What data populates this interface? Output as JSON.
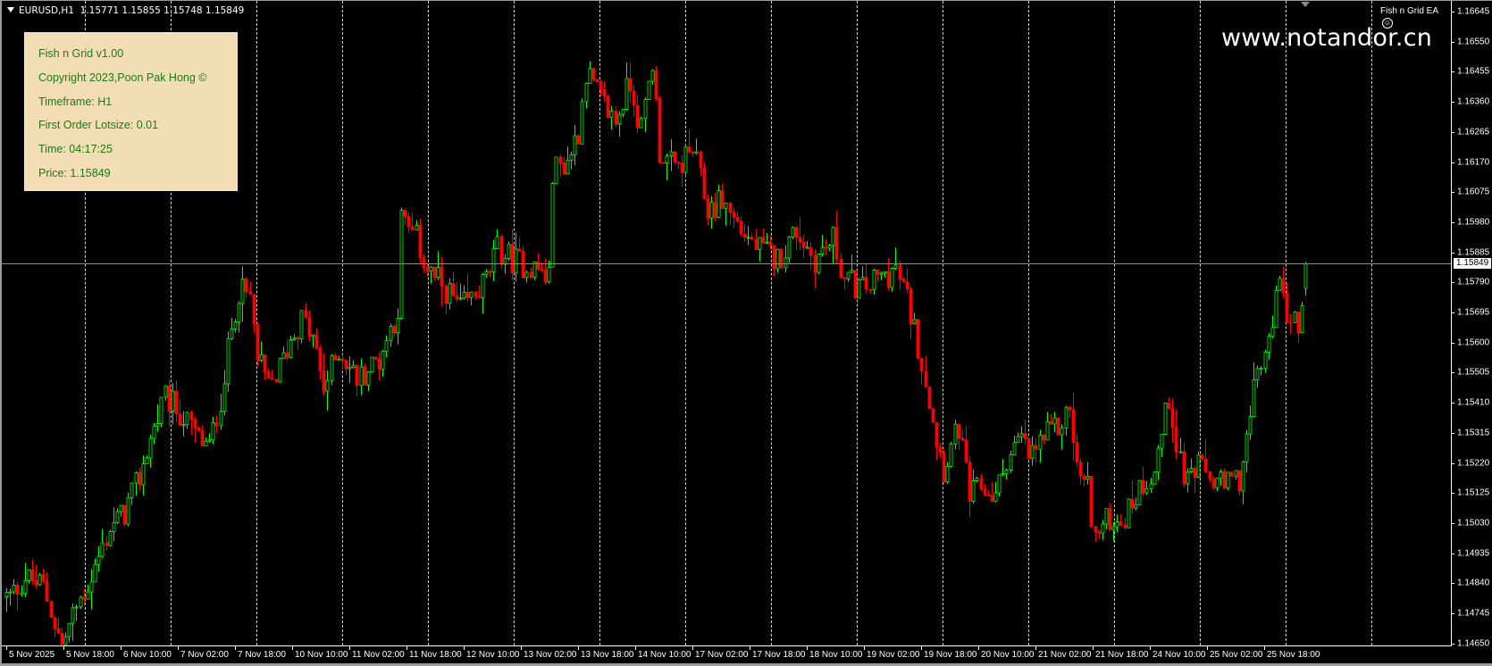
{
  "header": {
    "symbol": "EURUSD,H1",
    "ohlc": "1.15771 1.15855 1.15748 1.15849"
  },
  "info_panel": {
    "lines": [
      "Fish n Grid v1.00",
      "Copyright 2023,Poon Pak Hong ©",
      "Timeframe: H1",
      "First Order Lotsize: 0.01",
      "Time: 04:17:25",
      "Price: 1.15849"
    ],
    "bg_color": "#f3ddb4",
    "text_color": "#1e7a18"
  },
  "watermark": "www.notandor.cn",
  "ea_label": "Fish n Grid EA",
  "ea_icon": "smiley-icon",
  "colors": {
    "bull": "#00ff00",
    "bear": "#ff0000",
    "background": "#000000",
    "grid": "#d0d0d0"
  },
  "chart_data": {
    "type": "candlestick",
    "symbol": "EURUSD",
    "timeframe": "H1",
    "current_price": "1.15849",
    "last_bar": {
      "open": 1.15771,
      "high": 1.15855,
      "low": 1.15748,
      "close": 1.15849
    },
    "ylim": [
      1.1465,
      1.16645
    ],
    "y_ticks": [
      "1.16645",
      "1.16550",
      "1.16455",
      "1.16360",
      "1.16265",
      "1.16170",
      "1.16075",
      "1.15980",
      "1.15885",
      "1.15790",
      "1.15695",
      "1.15600",
      "1.15505",
      "1.15410",
      "1.15315",
      "1.15220",
      "1.15125",
      "1.15030",
      "1.14935",
      "1.14840",
      "1.14745",
      "1.14650"
    ],
    "x_ticks": [
      "5 Nov 2025",
      "5 Nov 18:00",
      "6 Nov 10:00",
      "7 Nov 02:00",
      "7 Nov 18:00",
      "10 Nov 10:00",
      "11 Nov 02:00",
      "11 Nov 18:00",
      "12 Nov 10:00",
      "13 Nov 02:00",
      "13 Nov 18:00",
      "14 Nov 10:00",
      "17 Nov 02:00",
      "17 Nov 18:00",
      "18 Nov 10:00",
      "19 Nov 02:00",
      "19 Nov 18:00",
      "20 Nov 10:00",
      "21 Nov 02:00",
      "21 Nov 18:00",
      "24 Nov 10:00",
      "25 Nov 02:00",
      "25 Nov 18:00"
    ],
    "bars_per_x_tick": 16,
    "price_path": [
      [
        1,
        1.14797
      ],
      [
        5,
        1.1486
      ],
      [
        10,
        1.14829
      ],
      [
        15,
        1.14641
      ],
      [
        19,
        1.14766
      ],
      [
        23,
        1.1486
      ],
      [
        28,
        1.15016
      ],
      [
        32,
        1.15063
      ],
      [
        36,
        1.15173
      ],
      [
        39,
        1.15298
      ],
      [
        43,
        1.15424
      ],
      [
        46,
        1.15392
      ],
      [
        52,
        1.15298
      ],
      [
        55,
        1.15267
      ],
      [
        58,
        1.15424
      ],
      [
        61,
        1.15643
      ],
      [
        63,
        1.15768
      ],
      [
        66,
        1.15737
      ],
      [
        68,
        1.15549
      ],
      [
        71,
        1.15455
      ],
      [
        74,
        1.15518
      ],
      [
        77,
        1.15611
      ],
      [
        80,
        1.15674
      ],
      [
        83,
        1.15611
      ],
      [
        86,
        1.15455
      ],
      [
        90,
        1.1558
      ],
      [
        95,
        1.15486
      ],
      [
        101,
        1.15549
      ],
      [
        103,
        1.15611
      ],
      [
        106,
        1.15705
      ],
      [
        107,
        1.15987
      ],
      [
        111,
        1.15925
      ],
      [
        114,
        1.15831
      ],
      [
        119,
        1.15768
      ],
      [
        123,
        1.15705
      ],
      [
        126,
        1.15737
      ],
      [
        130,
        1.15799
      ],
      [
        133,
        1.15893
      ],
      [
        137,
        1.15862
      ],
      [
        141,
        1.15846
      ],
      [
        144,
        1.15831
      ],
      [
        147,
        1.15799
      ],
      [
        148,
        1.16144
      ],
      [
        152,
        1.16175
      ],
      [
        155,
        1.16269
      ],
      [
        157,
        1.16457
      ],
      [
        161,
        1.16363
      ],
      [
        165,
        1.163
      ],
      [
        169,
        1.16426
      ],
      [
        172,
        1.16269
      ],
      [
        175,
        1.16488
      ],
      [
        177,
        1.16207
      ],
      [
        181,
        1.16144
      ],
      [
        186,
        1.16207
      ],
      [
        190,
        1.16019
      ],
      [
        194,
        1.1605
      ],
      [
        199,
        1.15956
      ],
      [
        204,
        1.15893
      ],
      [
        209,
        1.15862
      ],
      [
        214,
        1.15956
      ],
      [
        219,
        1.15862
      ],
      [
        224,
        1.15925
      ],
      [
        227,
        1.15799
      ],
      [
        232,
        1.15768
      ],
      [
        236,
        1.15799
      ],
      [
        241,
        1.15831
      ],
      [
        244,
        1.15737
      ],
      [
        246,
        1.15643
      ],
      [
        249,
        1.15486
      ],
      [
        252,
        1.15298
      ],
      [
        254,
        1.15204
      ],
      [
        258,
        1.1533
      ],
      [
        261,
        1.1511
      ],
      [
        264,
        1.15142
      ],
      [
        268,
        1.1511
      ],
      [
        271,
        1.15236
      ],
      [
        275,
        1.15298
      ],
      [
        277,
        1.15236
      ],
      [
        281,
        1.15298
      ],
      [
        285,
        1.1533
      ],
      [
        288,
        1.15392
      ],
      [
        290,
        1.15204
      ],
      [
        293,
        1.15142
      ],
      [
        295,
        1.14985
      ],
      [
        299,
        1.15048
      ],
      [
        303,
        1.15048
      ],
      [
        307,
        1.15142
      ],
      [
        311,
        1.15204
      ],
      [
        315,
        1.15424
      ],
      [
        319,
        1.15173
      ],
      [
        323,
        1.15204
      ],
      [
        326,
        1.15173
      ],
      [
        330,
        1.15142
      ],
      [
        334,
        1.15173
      ],
      [
        337,
        1.15361
      ],
      [
        339,
        1.15518
      ],
      [
        342,
        1.1558
      ],
      [
        344,
        1.15799
      ],
      [
        347,
        1.15705
      ],
      [
        350,
        1.15643
      ],
      [
        352,
        1.15849
      ]
    ]
  }
}
